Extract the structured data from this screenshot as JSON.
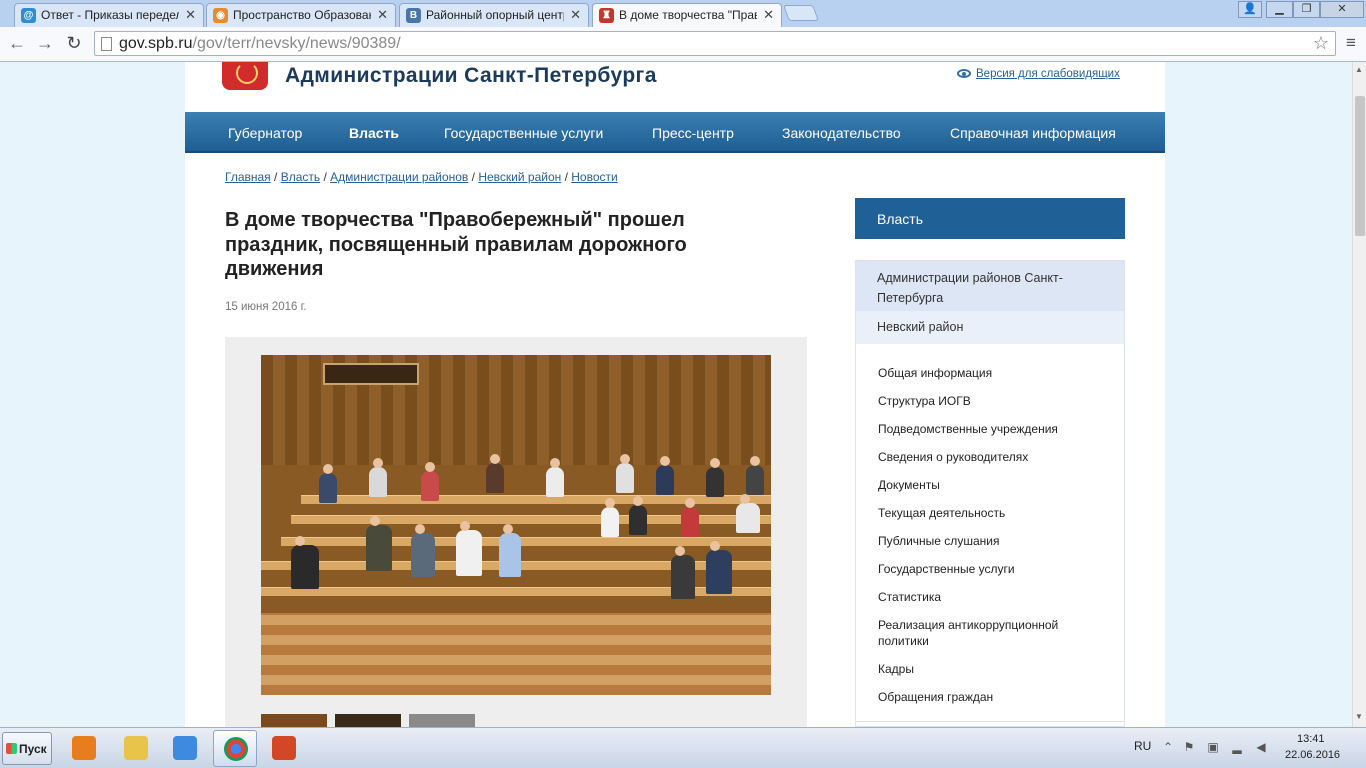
{
  "browser": {
    "tabs": [
      {
        "title": "Ответ - Приказы переделал",
        "icon": "globe-icon",
        "color": "#2c8fd6",
        "active": false
      },
      {
        "title": "Пространство Образовани",
        "icon": "orange-logo-icon",
        "color": "#e88b2e",
        "active": false
      },
      {
        "title": "Районный опорный центр Н",
        "icon": "vk-icon",
        "color": "#4a76a8",
        "active": false
      },
      {
        "title": "В доме творчества \"Правоб",
        "icon": "spb-crest-icon",
        "color": "#c0392b",
        "active": true
      }
    ],
    "url_domain": "gov.spb.ru",
    "url_path": "/gov/terr/nevsky/news/90389/"
  },
  "site": {
    "title": "Администрации Санкт-Петербурга",
    "impaired_version": "Версия для слабовидящих",
    "nav": [
      {
        "label": "Губернатор",
        "active": false
      },
      {
        "label": "Власть",
        "active": true
      },
      {
        "label": "Государственные услуги",
        "active": false
      },
      {
        "label": "Пресс-центр",
        "active": false
      },
      {
        "label": "Законодательство",
        "active": false
      },
      {
        "label": "Справочная информация",
        "active": false
      }
    ]
  },
  "breadcrumb": [
    {
      "label": "Главная"
    },
    {
      "label": "Власть"
    },
    {
      "label": "Администрации районов"
    },
    {
      "label": "Невский район"
    },
    {
      "label": "Новости"
    }
  ],
  "breadcrumb_separator": " / ",
  "article": {
    "title": "В доме творчества \"Правобережный\" прошел праздник, посвященный правилам дорожного движения",
    "date": "15 июня 2016 г."
  },
  "sidebar": {
    "header": "Власть",
    "sub1": "Администрации районов Санкт-Петербурга",
    "sub2": "Невский район",
    "links": [
      "Общая информация",
      "Структура ИОГВ",
      "Подведомственные учреждения",
      "Сведения о руководителях",
      "Документы",
      "Текущая деятельность",
      "Публичные слушания",
      "Государственные услуги",
      "Статистика",
      "Реализация антикоррупционной политики",
      "Кадры",
      "Обращения граждан"
    ]
  },
  "taskbar": {
    "start_label": "Пуск",
    "apps": [
      {
        "name": "media-player-icon",
        "color": "#e87d1e",
        "active": false
      },
      {
        "name": "file-explorer-icon",
        "color": "#e8c44a",
        "active": false
      },
      {
        "name": "google-drive-icon",
        "color": "#3d8ae0",
        "active": false
      },
      {
        "name": "chrome-icon",
        "color": "#db4437",
        "active": true
      },
      {
        "name": "powerpoint-icon",
        "color": "#d24726",
        "active": false
      }
    ],
    "language": "RU",
    "time": "13:41",
    "date": "22.06.2016"
  }
}
